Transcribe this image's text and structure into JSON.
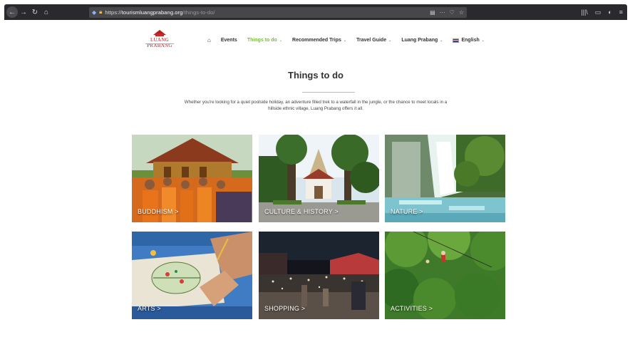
{
  "browser": {
    "url_scheme": "https://",
    "url_host": "tourismluangprabang.org",
    "url_path": "/things-to-do/",
    "actions": [
      "▤",
      "···",
      "♡",
      "☆"
    ],
    "right_icons": [
      "|||\\",
      "▭",
      "◐",
      "≡"
    ]
  },
  "nav": {
    "home_icon": "⌂",
    "items": [
      {
        "label": "Events",
        "has_caret": false
      },
      {
        "label": "Things to do",
        "has_caret": true,
        "active": true
      },
      {
        "label": "Recommended Trips",
        "has_caret": true
      },
      {
        "label": "Travel Guide",
        "has_caret": true
      },
      {
        "label": "Luang Prabang",
        "has_caret": true
      },
      {
        "label": "English",
        "has_caret": true
      }
    ]
  },
  "logo": {
    "name": "LUANG PRABANG"
  },
  "main": {
    "title": "Things to do",
    "intro": "Whether you're looking for a quiet poolside holiday, an adventure filled trek to a waterfall in the jungle, or the chance to meet locals in a hillside ethnic village, Luang Prabang offers it all."
  },
  "tiles": [
    {
      "label": "BUDDHISM >"
    },
    {
      "label": "CULTURE & HISTORY >"
    },
    {
      "label": "NATURE >"
    },
    {
      "label": "ARTS >"
    },
    {
      "label": "SHOPPING >"
    },
    {
      "label": "ACTIVITIES >"
    }
  ],
  "colors": {
    "accent_green": "#7dbb3c",
    "logo_red": "#b71c1c"
  }
}
